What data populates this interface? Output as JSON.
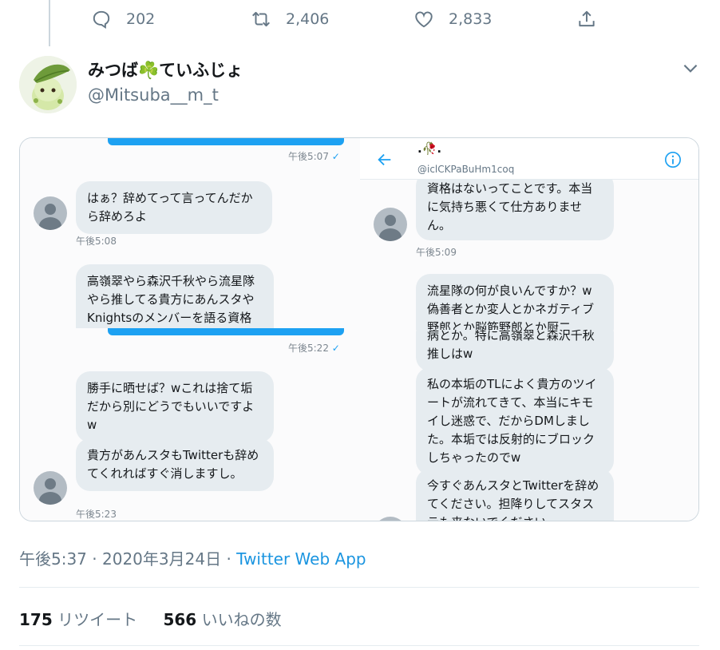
{
  "prev_tweet": {
    "replies": "202",
    "retweets": "2,406",
    "likes": "2,833"
  },
  "tweet": {
    "display_name": "みつば☘️ていふじょ",
    "handle": "@Mitsuba__m_t",
    "timestamp": "午後5:37",
    "date": "2020年3月24日",
    "via": "Twitter Web App",
    "retweet_count": "175",
    "retweet_label": "リツイート",
    "like_count": "566",
    "like_label": "いいねの数"
  },
  "screenshot_left": {
    "top": {
      "sent_time": "午後5:07",
      "msg1": "はぁ？辞めてって言ってんだから辞めろよ",
      "msg1_time": "午後5:08",
      "msg2": "高嶺翠やら森沢千秋やら流星隊やら推してる貴方にあんスタやKnightsのメンバーを語る資格はないってことです。本"
    },
    "bottom": {
      "sent_time": "午後5:22",
      "msg1": "勝手に晒せば？wこれは捨て垢だから別にどうでもいいですよw",
      "msg2": "貴方があんスタもTwitterも辞めてくれればすぐ消しますし。",
      "msg2_time": "午後5:23"
    }
  },
  "screenshot_right": {
    "top": {
      "name": ".🥀.",
      "handle": "@iclCKPaBuHm1coq",
      "msg1": "資格はないってことです。本当に気持ち悪くて仕方ありません。",
      "msg1_time": "午後5:09",
      "msg2": "流星隊の何が良いんですか？w偽善者とか変人とかネガティブ野郎とか脳筋野郎とか厨二"
    },
    "bottom": {
      "msg0": "病とか。特に高嶺翠と森沢千秋推しはw",
      "msg1": "私の本垢のTLによく貴方のツイートが流れてきて、本当にキモイし迷惑で、だからDMしました。本垢では反射的にブロックしちゃったのでw",
      "msg2": "今すぐあんスタとTwitterを辞めてください。担降りしてスタステも来ないでください。"
    }
  },
  "colors": {
    "accent": "#1da1f2",
    "link": "#1b95e0",
    "muted": "#657786",
    "bubble": "#e6ecf0"
  },
  "icons": [
    "reply-icon",
    "retweet-icon",
    "like-icon",
    "share-icon",
    "chevron-down-icon",
    "back-arrow-icon",
    "info-icon",
    "clover-icon"
  ]
}
